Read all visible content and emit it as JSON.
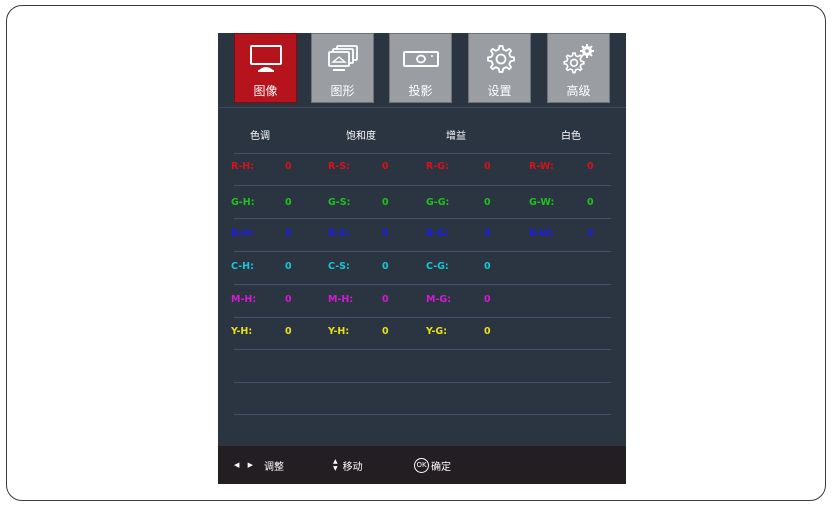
{
  "tabs": [
    {
      "label": "图像",
      "icon": "monitor-icon",
      "active": true
    },
    {
      "label": "图形",
      "icon": "layers-icon",
      "active": false
    },
    {
      "label": "投影",
      "icon": "projector-icon",
      "active": false
    },
    {
      "label": "设置",
      "icon": "gear-icon",
      "active": false
    },
    {
      "label": "高级",
      "icon": "gears-icon",
      "active": false
    }
  ],
  "headers": [
    "色调",
    "饱和度",
    "增益",
    "白色"
  ],
  "rows": [
    {
      "color": "#d8121a",
      "cells": [
        {
          "label": "R-H:",
          "value": "0"
        },
        {
          "label": "R-S:",
          "value": "0"
        },
        {
          "label": "R-G:",
          "value": "0"
        },
        {
          "label": "R-W:",
          "value": "0"
        }
      ]
    },
    {
      "color": "#1fc21f",
      "cells": [
        {
          "label": "G-H:",
          "value": "0"
        },
        {
          "label": "G-S:",
          "value": "0"
        },
        {
          "label": "G-G:",
          "value": "0"
        },
        {
          "label": "G-W:",
          "value": "0"
        }
      ]
    },
    {
      "color": "#1a1ee0",
      "cells": [
        {
          "label": "B-H:",
          "value": "0"
        },
        {
          "label": "B-S:",
          "value": "0"
        },
        {
          "label": "B-G:",
          "value": "0"
        },
        {
          "label": "B-W:",
          "value": "0"
        }
      ]
    },
    {
      "color": "#19c6d8",
      "cells": [
        {
          "label": "C-H:",
          "value": "0"
        },
        {
          "label": "C-S:",
          "value": "0"
        },
        {
          "label": "C-G:",
          "value": "0"
        }
      ]
    },
    {
      "color": "#d21bd2",
      "cells": [
        {
          "label": "M-H:",
          "value": "0"
        },
        {
          "label": "M-H:",
          "value": "0"
        },
        {
          "label": "M-G:",
          "value": "0"
        }
      ]
    },
    {
      "color": "#e8e21a",
      "cells": [
        {
          "label": "Y-H:",
          "value": "0"
        },
        {
          "label": "Y-H:",
          "value": "0"
        },
        {
          "label": "Y-G:",
          "value": "0"
        }
      ]
    }
  ],
  "footer": {
    "adjust": "调整",
    "move": "移动",
    "ok_badge": "OK",
    "confirm": "确定"
  },
  "colors": {
    "panel_bg": "#2b3441",
    "active_tab": "#b5141c",
    "inactive_tab": "#9a9ea3",
    "footer_bg": "#221e22"
  }
}
